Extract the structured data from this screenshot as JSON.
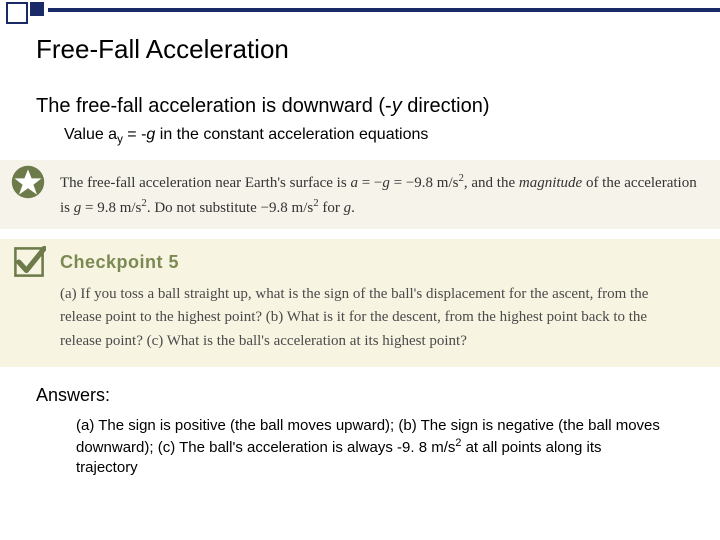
{
  "title": "Free-Fall Acceleration",
  "lead_pre": "The free-fall acceleration is downward (-",
  "lead_var": "y",
  "lead_post": " direction)",
  "sub_pre": "Value a",
  "sub_subscript": "y",
  "sub_mid": " = -",
  "sub_g": "g",
  "sub_post": " in the constant acceleration equations",
  "callout": {
    "t1": "The free-fall acceleration near Earth's surface is ",
    "a": "a",
    "t2": " = −",
    "g1": "g",
    "t3": " = −9.8 m/s",
    "exp": "2",
    "t4": ", and the ",
    "mag": "magnitude",
    "t5": " of the acceleration is ",
    "g2": "g",
    "t6": " = 9.8 m/s",
    "t7": ". Do not substitute −9.8 m/s",
    "t8": " for ",
    "g3": "g",
    "t9": "."
  },
  "checkpoint": {
    "title": "Checkpoint 5",
    "body": "(a) If you toss a ball straight up, what is the sign of the ball's displacement for the ascent, from the release point to the highest point? (b) What is it for the descent, from the highest point back to the release point? (c) What is the ball's acceleration at its highest point?"
  },
  "answers_label": "Answers:",
  "answers": {
    "t1": "(a) The sign is positive (the ball moves upward); (b) The sign is negative (the ball moves downward); (c) The ball's acceleration is always -9. 8 m/s",
    "exp": "2",
    "t2": " at all points along its trajectory"
  },
  "icons": {
    "star": "star-icon",
    "check": "check-icon"
  }
}
